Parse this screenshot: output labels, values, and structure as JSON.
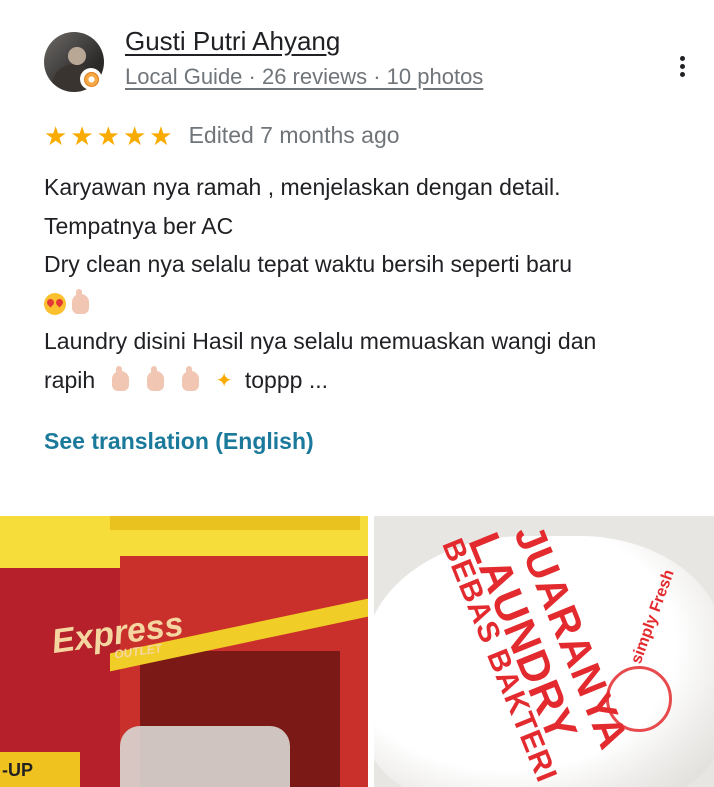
{
  "reviewer": {
    "name": "Gusti Putri Ahyang",
    "meta": "Local Guide · 26 reviews · 10 photos"
  },
  "review": {
    "rating": 5,
    "rating_max": 5,
    "edited": "Edited 7 months ago",
    "lines": [
      "Karyawan nya ramah , menjelaskan dengan detail.",
      "Tempatnya ber AC",
      "Dry clean nya selalu tepat waktu bersih seperti baru",
      "",
      "Laundry disini Hasil nya selalu memuaskan wangi dan",
      "rapih",
      "toppp ..."
    ],
    "see_translation": "See translation (English)"
  },
  "photos": {
    "photo1": {
      "logo_text": "Express",
      "logo_sub": "OUTLET",
      "sign_text": "-UP"
    },
    "photo2": {
      "text_1": "JUARANYA",
      "text_2": "LAUNDRY",
      "text_3": "BEBAS BAKTERI",
      "brand": "simply Fresh"
    }
  },
  "colors": {
    "star": "#f9ab00",
    "link": "#1b7a9b",
    "secondary_text": "#70757a"
  },
  "icons": {
    "more": "more-vert-icon",
    "badge": "local-guide-badge-icon",
    "star": "star-icon"
  }
}
